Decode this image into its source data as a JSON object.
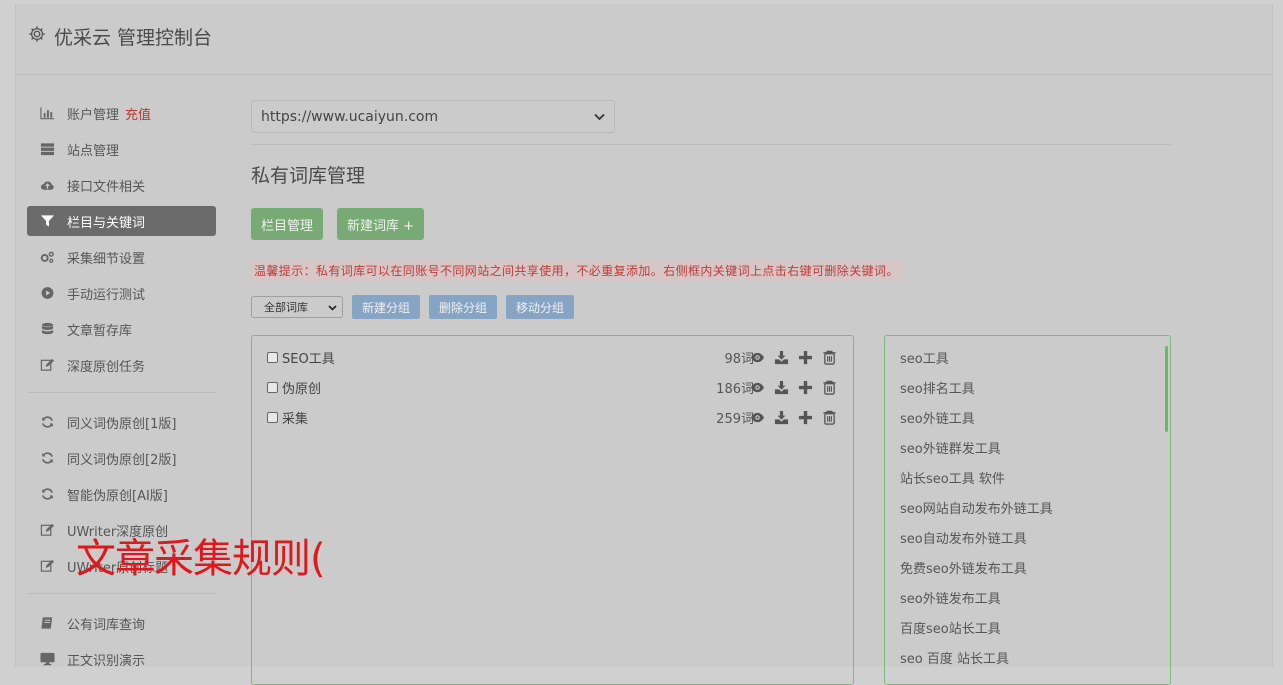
{
  "header": {
    "title": "优采云 管理控制台",
    "icon": "gear-icon"
  },
  "sidebar": {
    "groups": [
      [
        {
          "label": "账户管理",
          "tag": "充值",
          "icon": "bar-chart-icon"
        },
        {
          "label": "站点管理",
          "icon": "server-icon"
        },
        {
          "label": "接口文件相关",
          "icon": "cloud-upload-icon"
        },
        {
          "label": "栏目与关键词",
          "icon": "filter-icon",
          "active": true
        },
        {
          "label": "采集细节设置",
          "icon": "gears-icon"
        },
        {
          "label": "手动运行测试",
          "icon": "play-circle-icon"
        },
        {
          "label": "文章暂存库",
          "icon": "database-icon"
        },
        {
          "label": "深度原创任务",
          "icon": "edit-icon"
        }
      ],
      [
        {
          "label": "同义词伪原创[1版]",
          "icon": "refresh-icon"
        },
        {
          "label": "同义词伪原创[2版]",
          "icon": "refresh-icon"
        },
        {
          "label": "智能伪原创[AI版]",
          "icon": "refresh-icon"
        },
        {
          "label": "UWriter深度原创",
          "icon": "edit-icon"
        },
        {
          "label": "UWriter原创标题",
          "icon": "edit-icon"
        }
      ],
      [
        {
          "label": "公有词库查询",
          "icon": "book-icon"
        },
        {
          "label": "正文识别演示",
          "icon": "desktop-icon"
        }
      ]
    ]
  },
  "main": {
    "site_select": "https://www.ucaiyun.com",
    "title": "私有词库管理",
    "buttons": {
      "column_manage": "栏目管理",
      "new_lib": "新建词库 +"
    },
    "tip": "温馨提示：私有词库可以在同账号不同网站之间共享使用，不必重复添加。右侧框内关键词上点击右键可删除关键词。",
    "group_select": "全部词库",
    "group_buttons": {
      "new": "新建分组",
      "delete": "删除分组",
      "move": "移动分组"
    },
    "libraries": [
      {
        "name": "SEO工具",
        "count": "98词"
      },
      {
        "name": "伪原创",
        "count": "186词"
      },
      {
        "name": "采集",
        "count": "259词"
      }
    ],
    "keywords": [
      "seo工具",
      "seo排名工具",
      "seo外链工具",
      "seo外链群发工具",
      "站长seo工具 软件",
      "seo网站自动发布外链工具",
      "seo自动发布外链工具",
      "免费seo外链发布工具",
      "seo外链发布工具",
      "百度seo站长工具",
      "seo 百度 站长工具"
    ]
  },
  "overlay": {
    "text": "文章采集规则("
  },
  "colors": {
    "active_nav": "#6b6b6b",
    "green_button": "#78ab74",
    "blue_button": "#86a5c5",
    "tip_text": "#c03a3a",
    "overlay_text": "#e0181b"
  }
}
